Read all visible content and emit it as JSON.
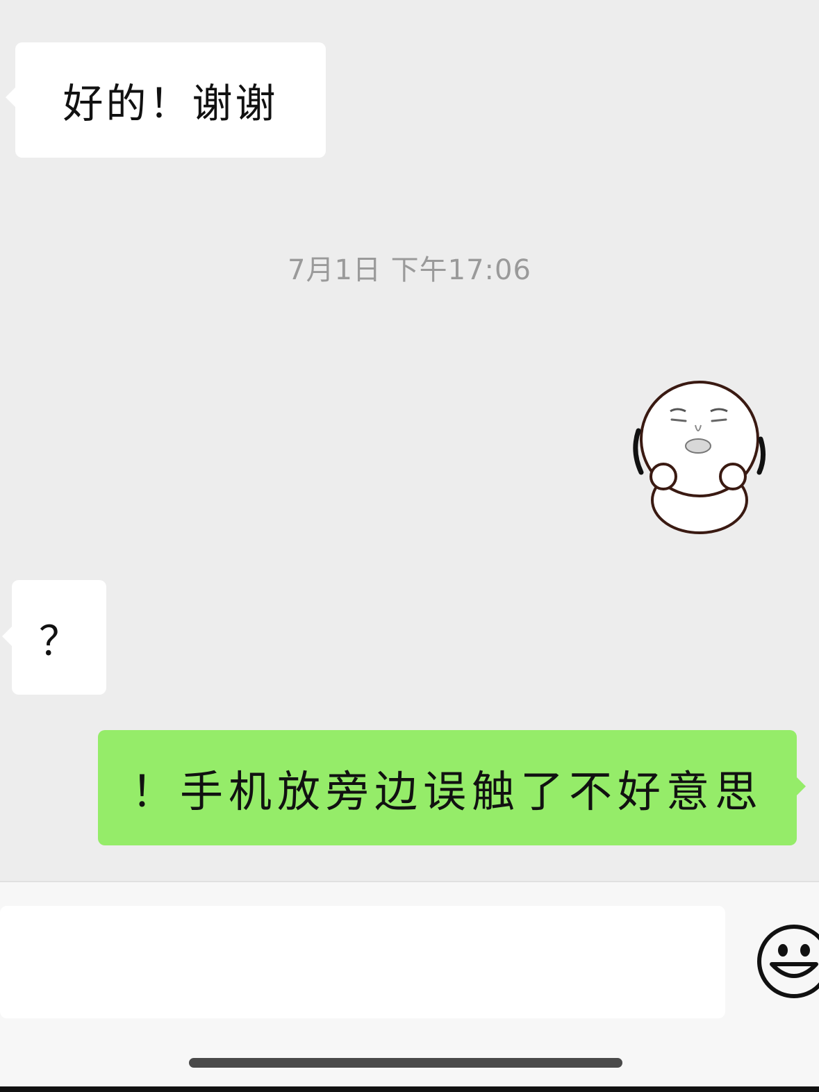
{
  "conversation": {
    "messages": [
      {
        "side": "left",
        "type": "text",
        "text": "好的！谢谢"
      },
      {
        "side": "left",
        "type": "text",
        "text": "？"
      },
      {
        "side": "right",
        "type": "text",
        "text": "！手机放旁边误触了不好意思"
      }
    ],
    "timestamp": "7月1日 下午17:06",
    "sticker": {
      "side": "right",
      "icon": "kissing-face-sticker-icon"
    }
  },
  "input_bar": {
    "value": "",
    "placeholder": "",
    "emoji_icon": "smiley-face-icon"
  },
  "colors": {
    "chat_background": "#ededed",
    "incoming_bubble": "#ffffff",
    "outgoing_bubble": "#95ec69",
    "timestamp_text": "#9a9a9a"
  }
}
